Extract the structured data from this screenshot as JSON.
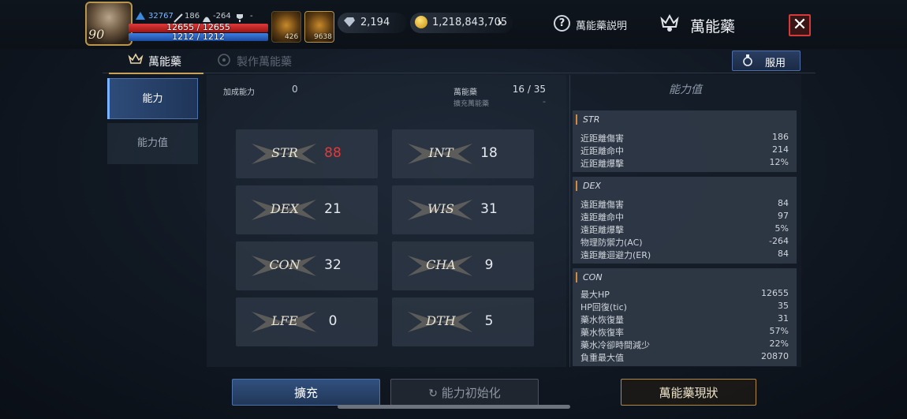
{
  "player": {
    "level": "90",
    "exp": "32767",
    "ac": "186",
    "mr": "-264",
    "trophy": "-",
    "hp": "12655 / 12655",
    "mp": "1212 / 1212",
    "slot1_count": "426",
    "slot2_count": "9638"
  },
  "currency": {
    "gems": "2,194",
    "gold": "1,218,843,705"
  },
  "header": {
    "help_label": "萬能藥説明",
    "title": "萬能藥",
    "close_symbol": "✕"
  },
  "tabs": {
    "tab1": "萬能藥",
    "tab2": "製作萬能藥",
    "use_button": "服用"
  },
  "nav": {
    "item1": "能力",
    "item2": "能力值"
  },
  "main": {
    "bonus_label": "加成能力",
    "bonus_value": "0",
    "elixir_label": "萬能藥",
    "elixir_value": "16 / 35",
    "expand_label": "擴充萬能藥",
    "expand_value": "-",
    "stats": [
      {
        "name": "STR",
        "value": "88",
        "color": "#e23a3a"
      },
      {
        "name": "INT",
        "value": "18",
        "color": "#e7ebf0"
      },
      {
        "name": "DEX",
        "value": "21",
        "color": "#e7ebf0"
      },
      {
        "name": "WIS",
        "value": "31",
        "color": "#e7ebf0"
      },
      {
        "name": "CON",
        "value": "32",
        "color": "#e7ebf0"
      },
      {
        "name": "CHA",
        "value": "9",
        "color": "#e7ebf0"
      },
      {
        "name": "LFE",
        "value": "0",
        "color": "#e7ebf0"
      },
      {
        "name": "DTH",
        "value": "5",
        "color": "#e7ebf0"
      }
    ]
  },
  "right": {
    "title": "能力值",
    "str": {
      "head": "STR",
      "rows": [
        {
          "k": "近距離傷害",
          "v": "186"
        },
        {
          "k": "近距離命中",
          "v": "214"
        },
        {
          "k": "近距離爆擊",
          "v": "12%"
        }
      ]
    },
    "dex": {
      "head": "DEX",
      "rows": [
        {
          "k": "遠距離傷害",
          "v": "84"
        },
        {
          "k": "遠距離命中",
          "v": "97"
        },
        {
          "k": "遠距離爆擊",
          "v": "5%"
        },
        {
          "k": "物理防禦力(AC)",
          "v": "-264"
        },
        {
          "k": "遠距離迴避力(ER)",
          "v": "84"
        }
      ]
    },
    "con": {
      "head": "CON",
      "rows": [
        {
          "k": "最大HP",
          "v": "12655"
        },
        {
          "k": "HP回復(tic)",
          "v": "35"
        },
        {
          "k": "藥水恢復量",
          "v": "31"
        },
        {
          "k": "藥水恢復率",
          "v": "57%"
        },
        {
          "k": "藥水冷卻時間減少",
          "v": "22%"
        },
        {
          "k": "負重最大值",
          "v": "20870"
        }
      ]
    }
  },
  "buttons": {
    "expand": "擴充",
    "reset": "能力初始化",
    "status": "萬能藥現狀"
  }
}
